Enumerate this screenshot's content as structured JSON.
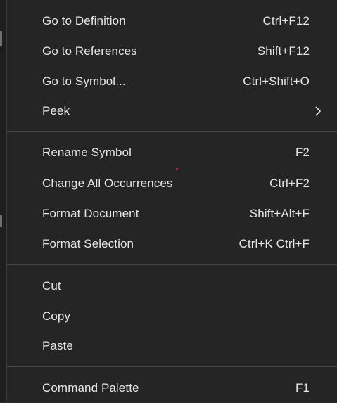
{
  "context_menu": {
    "groups": [
      {
        "items": [
          {
            "label": "Go to Definition",
            "shortcut": "Ctrl+F12"
          },
          {
            "label": "Go to References",
            "shortcut": "Shift+F12"
          },
          {
            "label": "Go to Symbol...",
            "shortcut": "Ctrl+Shift+O"
          },
          {
            "label": "Peek",
            "shortcut": "",
            "submenu_icon": "chevron-right-icon"
          }
        ]
      },
      {
        "items": [
          {
            "label": "Rename Symbol",
            "shortcut": "F2"
          },
          {
            "label": "Change All Occurrences",
            "shortcut": "Ctrl+F2"
          },
          {
            "label": "Format Document",
            "shortcut": "Shift+Alt+F"
          },
          {
            "label": "Format Selection",
            "shortcut": "Ctrl+K Ctrl+F"
          }
        ]
      },
      {
        "items": [
          {
            "label": "Cut",
            "shortcut": ""
          },
          {
            "label": "Copy",
            "shortcut": ""
          },
          {
            "label": "Paste",
            "shortcut": ""
          }
        ]
      },
      {
        "items": [
          {
            "label": "Command Palette",
            "shortcut": "F1"
          }
        ]
      }
    ]
  },
  "colors": {
    "menu_background": "#252526",
    "text": "#e6e6e6",
    "separator": "#454545"
  }
}
